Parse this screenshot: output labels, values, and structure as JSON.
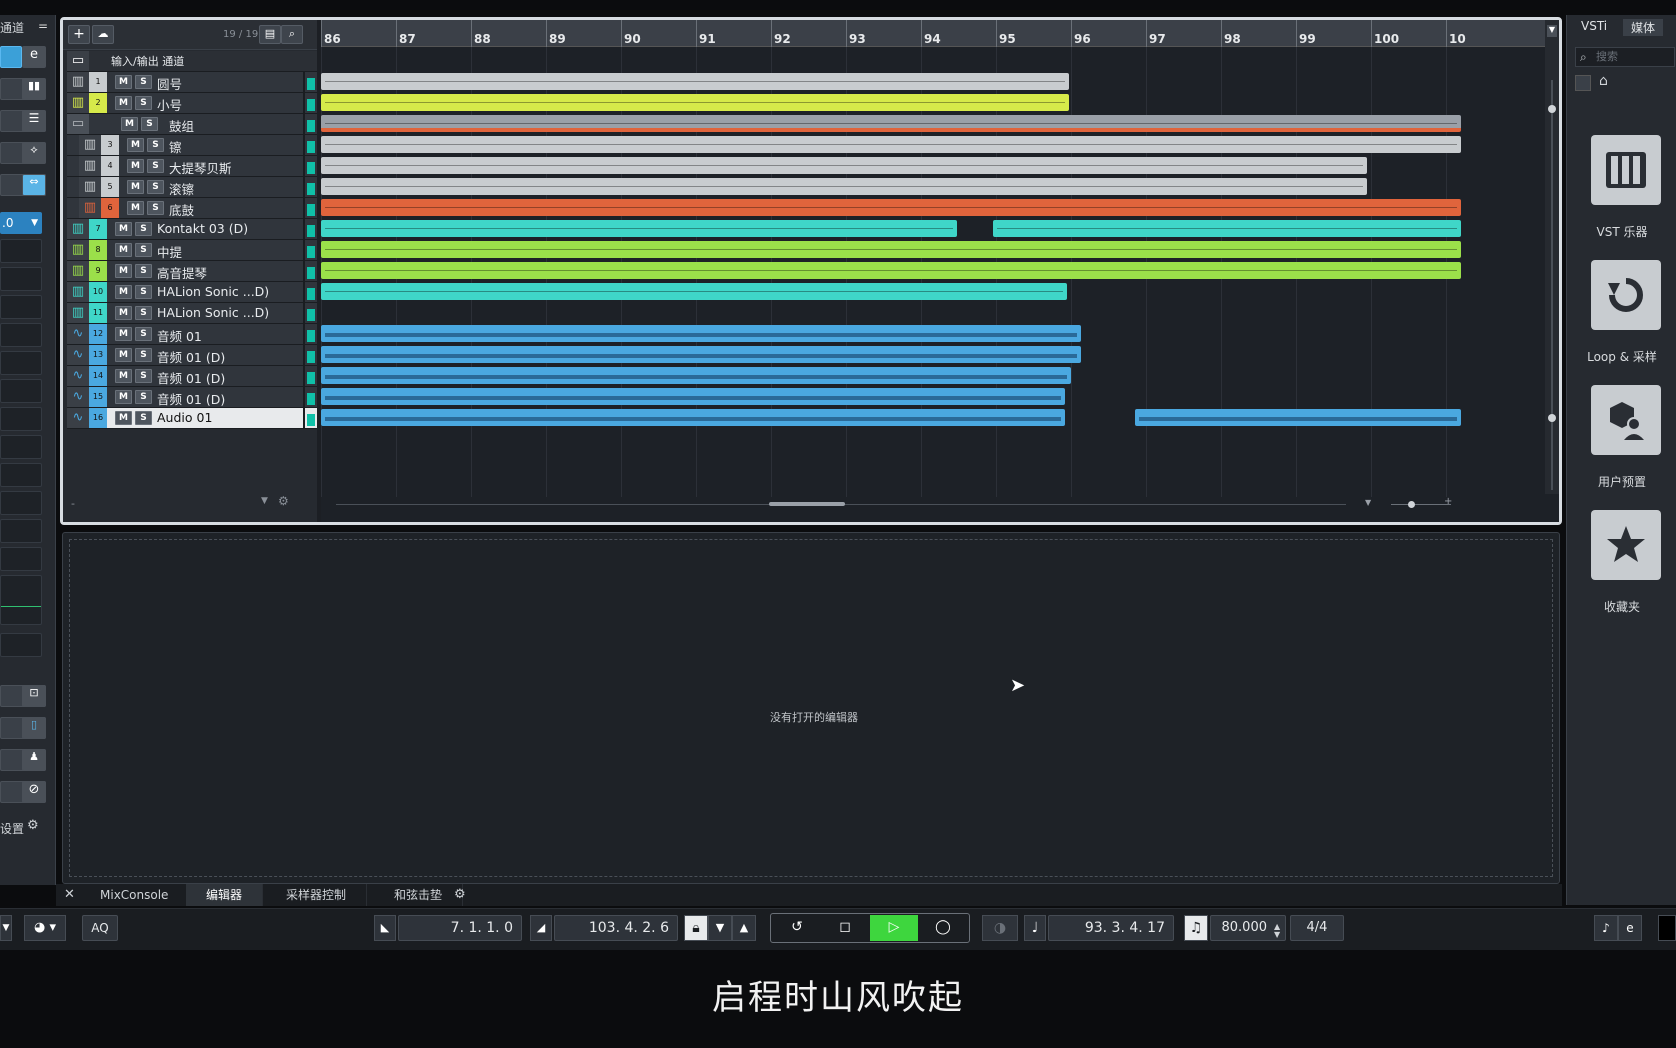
{
  "left_panel": {
    "title": "通道",
    "menu_icon": "hamburger-icon",
    "value_label": ".0",
    "settings_label": "设置"
  },
  "track_list": {
    "counter": "19 / 19",
    "header": "输入/输出 通道",
    "tracks": [
      {
        "num": "1",
        "name": "圆号",
        "kind": "instrument",
        "color": "#c8cccf"
      },
      {
        "num": "2",
        "name": "小号",
        "kind": "instrument",
        "color": "#d6ea4a"
      },
      {
        "num": "",
        "name": "鼓组",
        "kind": "folder",
        "color": "#b8bcc0"
      },
      {
        "num": "3",
        "name": "镲",
        "kind": "instrument",
        "color": "#c8cccf"
      },
      {
        "num": "4",
        "name": "大提琴贝斯",
        "kind": "instrument",
        "color": "#c8cccf"
      },
      {
        "num": "5",
        "name": "滚镲",
        "kind": "instrument",
        "color": "#c8cccf"
      },
      {
        "num": "6",
        "name": "底鼓",
        "kind": "instrument",
        "color": "#e0643c"
      },
      {
        "num": "7",
        "name": "Kontakt 03 (D)",
        "kind": "instrument",
        "color": "#3fd6c8"
      },
      {
        "num": "8",
        "name": "中提",
        "kind": "instrument",
        "color": "#9be04a"
      },
      {
        "num": "9",
        "name": "高音提琴",
        "kind": "instrument",
        "color": "#9be04a"
      },
      {
        "num": "10",
        "name": "HALion Sonic ...D)",
        "kind": "instrument",
        "color": "#3fd6c8"
      },
      {
        "num": "11",
        "name": "HALion Sonic ...D)",
        "kind": "instrument",
        "color": "#3fd6c8"
      },
      {
        "num": "12",
        "name": "音频 01",
        "kind": "audio",
        "color": "#4aa8e0"
      },
      {
        "num": "13",
        "name": "音频 01 (D)",
        "kind": "audio",
        "color": "#4aa8e0"
      },
      {
        "num": "14",
        "name": "音频 01 (D)",
        "kind": "audio",
        "color": "#4aa8e0"
      },
      {
        "num": "15",
        "name": "音频 01 (D)",
        "kind": "audio",
        "color": "#4aa8e0"
      },
      {
        "num": "16",
        "name": "Audio 01",
        "kind": "audio",
        "color": "#4aa8e0",
        "selected": true
      }
    ],
    "mute_label": "M",
    "solo_label": "S"
  },
  "ruler": {
    "bars": [
      "86",
      "87",
      "88",
      "89",
      "90",
      "91",
      "92",
      "93",
      "94",
      "95",
      "96",
      "97",
      "98",
      "99",
      "100",
      "10"
    ]
  },
  "editor": {
    "message": "没有打开的编辑器"
  },
  "bottom_tabs": [
    "MixConsole",
    "编辑器",
    "采样器控制",
    "和弦击垫"
  ],
  "active_tab": "编辑器",
  "transport": {
    "aq_label": "AQ",
    "left_locator": "7.  1.  1.    0",
    "right_locator": "103.  4.  2.    6",
    "position": "93.  3.  4.  17",
    "tempo": "80.000",
    "signature": "4/4"
  },
  "right_panel": {
    "tabs": [
      "VSTi",
      "媒体"
    ],
    "search_placeholder": "搜索",
    "tiles": [
      {
        "label": "VST 乐器",
        "icon": "piano-keys-icon"
      },
      {
        "label": "Loop & 采样",
        "icon": "loop-icon"
      },
      {
        "label": "用户预置",
        "icon": "user-preset-icon"
      },
      {
        "label": "收藏夹",
        "icon": "star-icon"
      }
    ]
  },
  "subtitle": "启程时山风吹起"
}
